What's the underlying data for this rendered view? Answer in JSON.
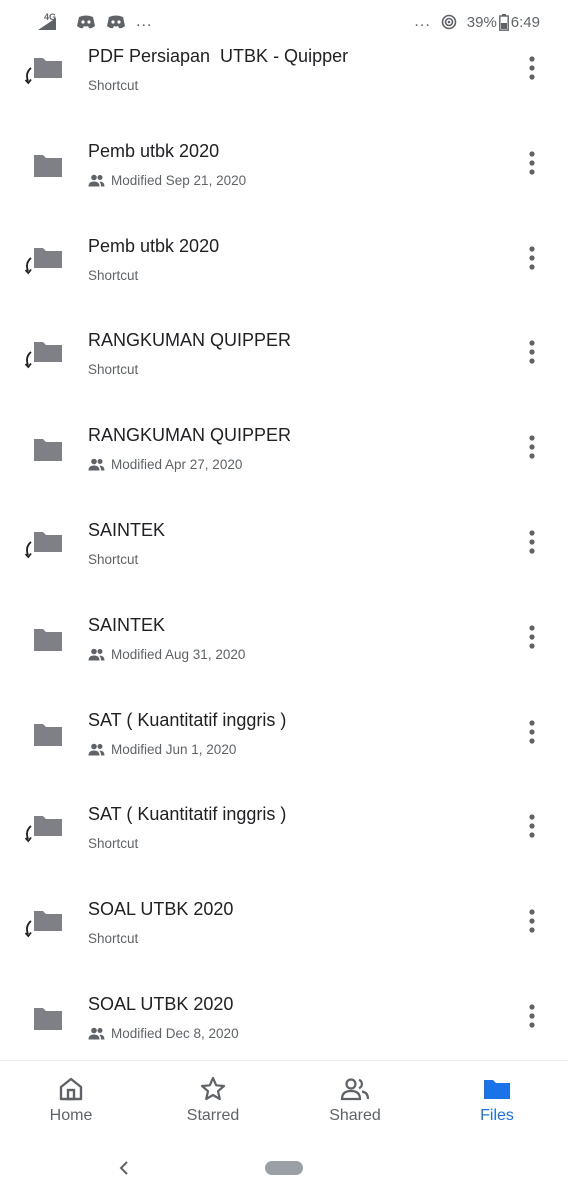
{
  "status_bar": {
    "network": "4G",
    "extra_indicator": "...",
    "battery_percent": "39%",
    "time": "6:49"
  },
  "files": [
    {
      "name": "PDF Persiapan  UTBK - Quipper",
      "meta": "Shortcut",
      "kind": "shortcut",
      "shared": false
    },
    {
      "name": "Pemb utbk 2020",
      "meta": "Modified Sep 21, 2020",
      "kind": "folder",
      "shared": true
    },
    {
      "name": "Pemb utbk 2020",
      "meta": "Shortcut",
      "kind": "shortcut",
      "shared": false
    },
    {
      "name": "RANGKUMAN QUIPPER",
      "meta": "Shortcut",
      "kind": "shortcut",
      "shared": false
    },
    {
      "name": "RANGKUMAN QUIPPER",
      "meta": "Modified Apr 27, 2020",
      "kind": "folder",
      "shared": true
    },
    {
      "name": "SAINTEK",
      "meta": "Shortcut",
      "kind": "shortcut",
      "shared": false
    },
    {
      "name": "SAINTEK",
      "meta": "Modified Aug 31, 2020",
      "kind": "folder",
      "shared": true
    },
    {
      "name": "SAT ( Kuantitatif inggris )",
      "meta": "Modified Jun 1, 2020",
      "kind": "folder",
      "shared": true
    },
    {
      "name": "SAT ( Kuantitatif inggris )",
      "meta": "Shortcut",
      "kind": "shortcut",
      "shared": false
    },
    {
      "name": "SOAL UTBK 2020",
      "meta": "Shortcut",
      "kind": "shortcut",
      "shared": false
    },
    {
      "name": "SOAL UTBK 2020",
      "meta": "Modified Dec 8, 2020",
      "kind": "folder",
      "shared": true
    }
  ],
  "bottom_nav": {
    "items": [
      {
        "label": "Home",
        "icon": "home-icon",
        "active": false
      },
      {
        "label": "Starred",
        "icon": "star-icon",
        "active": false
      },
      {
        "label": "Shared",
        "icon": "people-icon",
        "active": false
      },
      {
        "label": "Files",
        "icon": "folder-icon",
        "active": true
      }
    ]
  },
  "colors": {
    "folder_gray": "#7e8085",
    "accent_blue": "#1a73e8",
    "text_primary": "#202124",
    "text_secondary": "#5f6368"
  }
}
